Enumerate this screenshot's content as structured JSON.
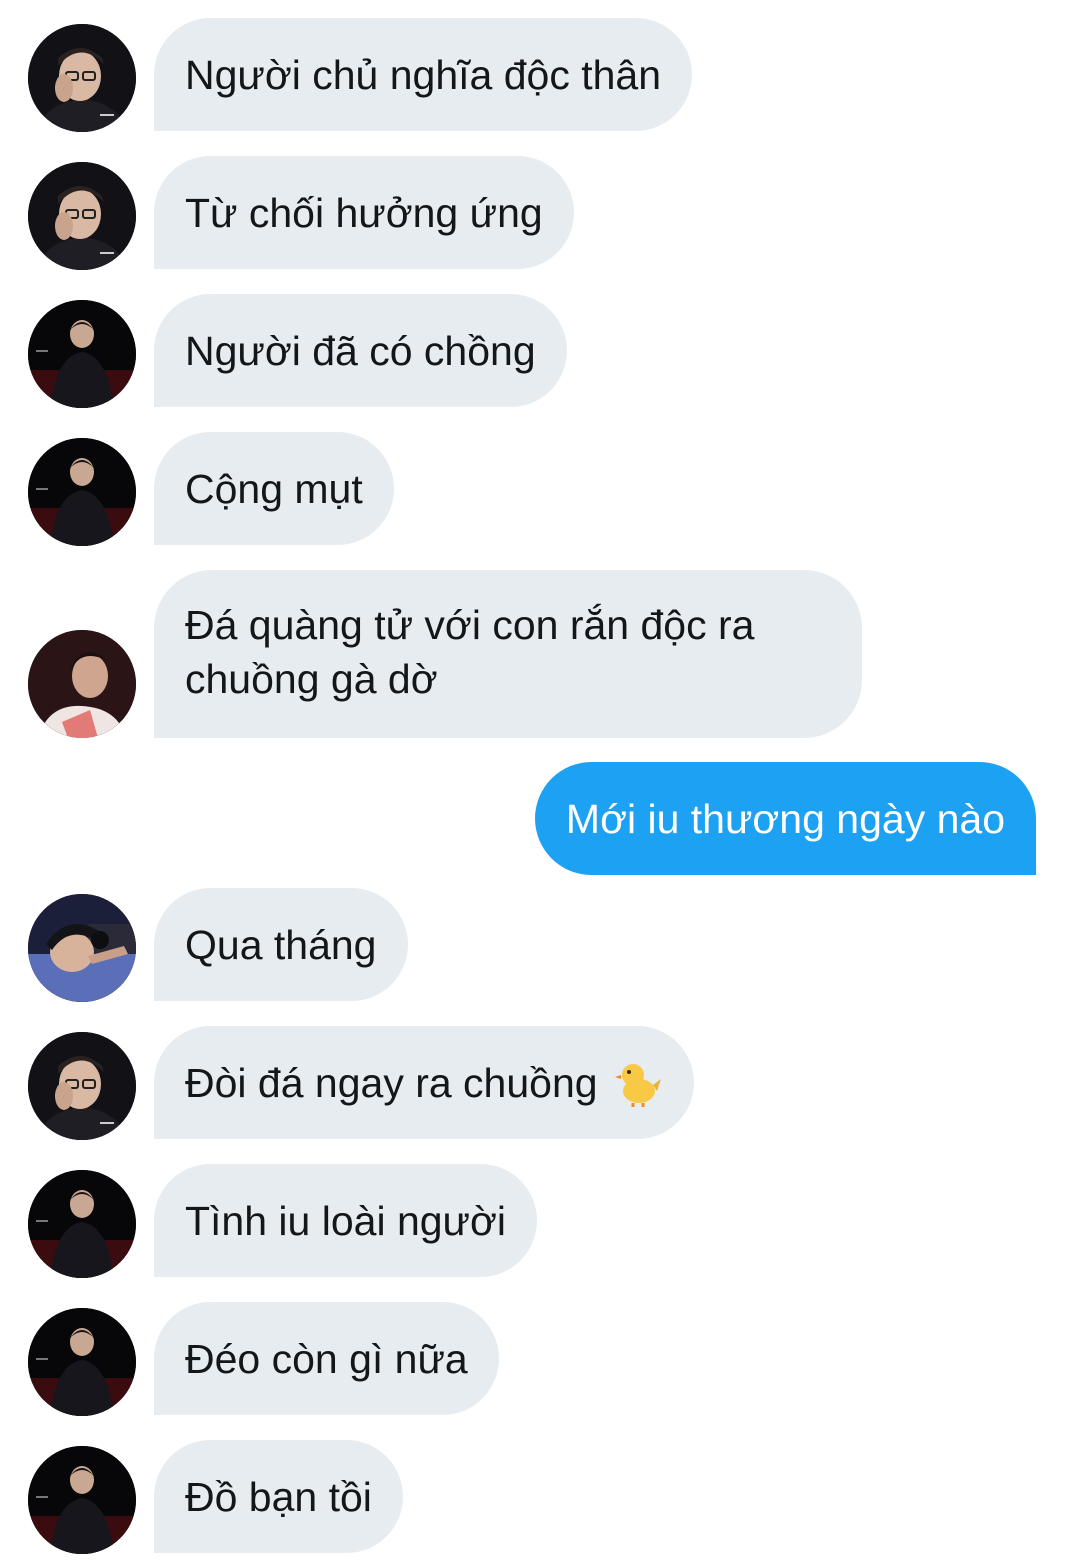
{
  "messages": [
    {
      "avatar": "avatar-glasses",
      "text": "Người chủ nghĩa độc thân"
    },
    {
      "avatar": "avatar-glasses",
      "text": "Từ chối hưởng ứng"
    },
    {
      "avatar": "avatar-dark-jacket",
      "text": "Người đã có chồng"
    },
    {
      "avatar": "avatar-dark-jacket",
      "text": "Cộng mụt"
    },
    {
      "avatar": "avatar-profile",
      "text": "Đá quàng tử với con rắn độc ra chuồng gà dờ"
    },
    {
      "outgoing": true,
      "text": "Mới iu thương ngày nào"
    },
    {
      "avatar": "avatar-headset",
      "text": "Qua tháng"
    },
    {
      "avatar": "avatar-glasses",
      "text": "Đòi đá ngay ra chuồng",
      "emoji": "baby-chick-icon"
    },
    {
      "avatar": "avatar-dark-jacket",
      "text": "Tình iu loài người"
    },
    {
      "avatar": "avatar-dark-jacket",
      "text": "Đéo còn gì nữa"
    },
    {
      "avatar": "avatar-dark-jacket",
      "text": "Đồ bạn tồi"
    }
  ],
  "colors": {
    "incoming_bubble": "#e6ecf0",
    "outgoing_bubble": "#1da1f2",
    "incoming_text": "#14171a",
    "outgoing_text": "#ffffff"
  }
}
